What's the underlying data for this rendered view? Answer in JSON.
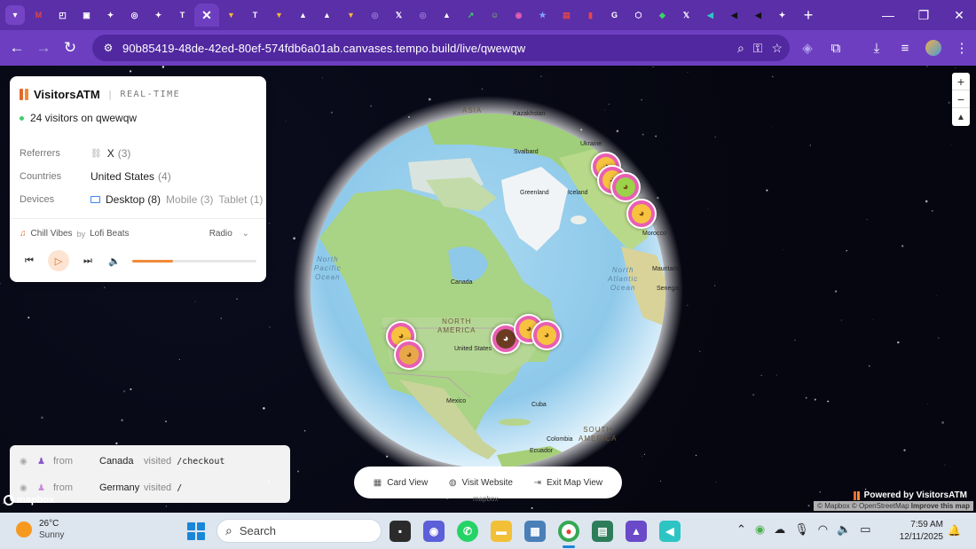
{
  "browser": {
    "tabs": [
      {
        "icon": "gmail-icon",
        "color": "#ea4335",
        "glyph": "M"
      },
      {
        "icon": "app-icon",
        "color": "#ffffff",
        "glyph": "◰"
      },
      {
        "icon": "app-icon",
        "color": "#ffffff",
        "glyph": "▣"
      },
      {
        "icon": "diamond-icon",
        "color": "#ffffff",
        "glyph": "✦"
      },
      {
        "icon": "openai-icon",
        "color": "#ffffff",
        "glyph": "◎"
      },
      {
        "icon": "diamond-icon",
        "color": "#ffffff",
        "glyph": "✦"
      },
      {
        "icon": "tempo-icon",
        "color": "#ffffff",
        "glyph": "T"
      },
      {
        "icon": "close-icon",
        "color": "#ffffff",
        "glyph": "✕",
        "active": true
      },
      {
        "icon": "v-icon",
        "color": "#f3b53a",
        "glyph": "▼"
      },
      {
        "icon": "tempo-icon",
        "color": "#ffffff",
        "glyph": "T"
      },
      {
        "icon": "v-icon",
        "color": "#f3b53a",
        "glyph": "▼"
      },
      {
        "icon": "triangle-icon",
        "color": "#ffffff",
        "glyph": "▲"
      },
      {
        "icon": "triangle-icon",
        "color": "#ffffff",
        "glyph": "▲"
      },
      {
        "icon": "v-icon",
        "color": "#f3b53a",
        "glyph": "▼"
      },
      {
        "icon": "ring-icon",
        "color": "#9a7ad6",
        "glyph": "◎"
      },
      {
        "icon": "x-icon",
        "color": "#ffffff",
        "glyph": "𝕏"
      },
      {
        "icon": "ring-icon",
        "color": "#9a7ad6",
        "glyph": "◎"
      },
      {
        "icon": "triangle-icon",
        "color": "#ffffff",
        "glyph": "▲"
      },
      {
        "icon": "chart-icon",
        "color": "#3ecf6e",
        "glyph": "↗"
      },
      {
        "icon": "smile-icon",
        "color": "#7bd84c",
        "glyph": "☺"
      },
      {
        "icon": "pink-icon",
        "color": "#e85fb2",
        "glyph": "◉"
      },
      {
        "icon": "star-icon",
        "color": "#7fa3ff",
        "glyph": "★"
      },
      {
        "icon": "red-icon",
        "color": "#e84545",
        "glyph": "▤"
      },
      {
        "icon": "bars-icon",
        "color": "#e84545",
        "glyph": "▮"
      },
      {
        "icon": "google-icon",
        "color": "#ffffff",
        "glyph": "G"
      },
      {
        "icon": "cube-icon",
        "color": "#ffffff",
        "glyph": "⬡"
      },
      {
        "icon": "leaf-icon",
        "color": "#3ecf6e",
        "glyph": "◆"
      },
      {
        "icon": "x-icon",
        "color": "#ffffff",
        "glyph": "𝕏"
      },
      {
        "icon": "teal-icon",
        "color": "#2ec4c4",
        "glyph": "◀"
      },
      {
        "icon": "dark-icon",
        "color": "#111111",
        "glyph": "◀"
      },
      {
        "icon": "dark-icon",
        "color": "#111111",
        "glyph": "◀"
      },
      {
        "icon": "diamond-icon",
        "color": "#ffffff",
        "glyph": "✦"
      }
    ],
    "url": "90b85419-48de-42ed-80ef-574fdb6a01ab.canvases.tempo.build/live/qwewqw"
  },
  "card": {
    "brand": "VisitorsATM",
    "separator": "|",
    "mode": "REAL-TIME",
    "live_text": "24 visitors on qwewqw",
    "referrers_label": "Referrers",
    "referrer_value": "X",
    "referrer_count": "(3)",
    "countries_label": "Countries",
    "country_value": "United States",
    "country_count": "(4)",
    "devices_label": "Devices",
    "device_desktop": "Desktop (8)",
    "device_mobile": "Mobile (3)",
    "device_tablet": "Tablet (1)",
    "track": "Chill Vibes",
    "by": "by",
    "artist": "Lofi Beats",
    "station": "Radio",
    "progress": 0.33,
    "accent": "#f08a3a"
  },
  "map": {
    "labels": {
      "asia": "ASIA",
      "kazakhstan": "Kazakhstan",
      "ukraine": "Ukraine",
      "svalbard": "Svalbard",
      "greenland": "Greenland",
      "iceland": "Iceland",
      "morocco": "Morocco",
      "mauritania": "Mauritania",
      "senegal": "Senegal",
      "north_pacific": "North\nPacific\nOcean",
      "north_atlantic": "North\nAtlantic\nOcean",
      "canada": "Canada",
      "north_america": "NORTH\nAMERICA",
      "united_states": "United States",
      "mexico": "Mexico",
      "cuba": "Cuba",
      "colombia": "Colombia",
      "south_america": "SOUTH\nAMERICA",
      "ecuador": "Ecuador"
    }
  },
  "feed": [
    {
      "from": "from",
      "country": "Canada",
      "visited": "visited",
      "path": "/checkout"
    },
    {
      "from": "from",
      "country": "Germany",
      "visited": "visited",
      "path": "/"
    }
  ],
  "actions": {
    "card_view": "Card View",
    "visit_website": "Visit Website",
    "exit_map": "Exit Map View"
  },
  "attribution": {
    "mapbox": "mapbox",
    "mapbox_center": "mapbox",
    "powered": "Powered by VisitorsATM",
    "copyright_mapbox": "© Mapbox",
    "copyright_osm": "© OpenStreetMap",
    "improve": "Improve this map"
  },
  "taskbar": {
    "temp": "26°C",
    "weather": "Sunny",
    "search_placeholder": "Search",
    "time": "7:59 AM",
    "date": "12/11/2025"
  }
}
